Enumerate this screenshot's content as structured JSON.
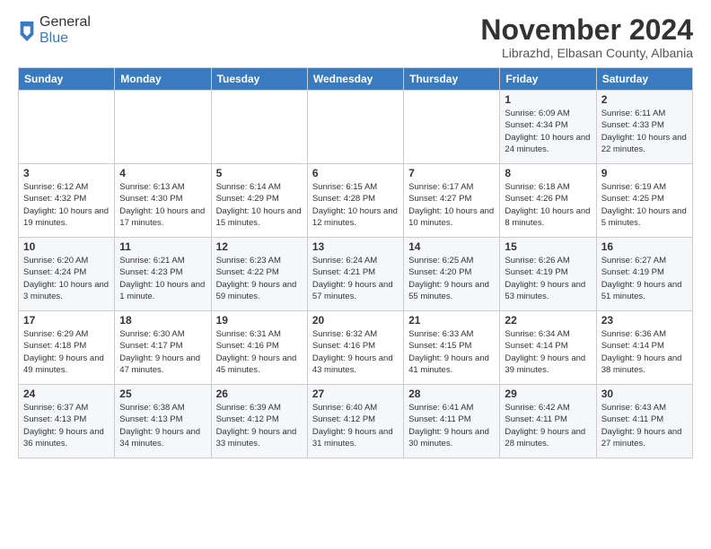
{
  "logo": {
    "general": "General",
    "blue": "Blue"
  },
  "header": {
    "month": "November 2024",
    "location": "Librazhd, Elbasan County, Albania"
  },
  "weekdays": [
    "Sunday",
    "Monday",
    "Tuesday",
    "Wednesday",
    "Thursday",
    "Friday",
    "Saturday"
  ],
  "weeks": [
    [
      {
        "day": "",
        "info": ""
      },
      {
        "day": "",
        "info": ""
      },
      {
        "day": "",
        "info": ""
      },
      {
        "day": "",
        "info": ""
      },
      {
        "day": "",
        "info": ""
      },
      {
        "day": "1",
        "info": "Sunrise: 6:09 AM\nSunset: 4:34 PM\nDaylight: 10 hours and 24 minutes."
      },
      {
        "day": "2",
        "info": "Sunrise: 6:11 AM\nSunset: 4:33 PM\nDaylight: 10 hours and 22 minutes."
      }
    ],
    [
      {
        "day": "3",
        "info": "Sunrise: 6:12 AM\nSunset: 4:32 PM\nDaylight: 10 hours and 19 minutes."
      },
      {
        "day": "4",
        "info": "Sunrise: 6:13 AM\nSunset: 4:30 PM\nDaylight: 10 hours and 17 minutes."
      },
      {
        "day": "5",
        "info": "Sunrise: 6:14 AM\nSunset: 4:29 PM\nDaylight: 10 hours and 15 minutes."
      },
      {
        "day": "6",
        "info": "Sunrise: 6:15 AM\nSunset: 4:28 PM\nDaylight: 10 hours and 12 minutes."
      },
      {
        "day": "7",
        "info": "Sunrise: 6:17 AM\nSunset: 4:27 PM\nDaylight: 10 hours and 10 minutes."
      },
      {
        "day": "8",
        "info": "Sunrise: 6:18 AM\nSunset: 4:26 PM\nDaylight: 10 hours and 8 minutes."
      },
      {
        "day": "9",
        "info": "Sunrise: 6:19 AM\nSunset: 4:25 PM\nDaylight: 10 hours and 5 minutes."
      }
    ],
    [
      {
        "day": "10",
        "info": "Sunrise: 6:20 AM\nSunset: 4:24 PM\nDaylight: 10 hours and 3 minutes."
      },
      {
        "day": "11",
        "info": "Sunrise: 6:21 AM\nSunset: 4:23 PM\nDaylight: 10 hours and 1 minute."
      },
      {
        "day": "12",
        "info": "Sunrise: 6:23 AM\nSunset: 4:22 PM\nDaylight: 9 hours and 59 minutes."
      },
      {
        "day": "13",
        "info": "Sunrise: 6:24 AM\nSunset: 4:21 PM\nDaylight: 9 hours and 57 minutes."
      },
      {
        "day": "14",
        "info": "Sunrise: 6:25 AM\nSunset: 4:20 PM\nDaylight: 9 hours and 55 minutes."
      },
      {
        "day": "15",
        "info": "Sunrise: 6:26 AM\nSunset: 4:19 PM\nDaylight: 9 hours and 53 minutes."
      },
      {
        "day": "16",
        "info": "Sunrise: 6:27 AM\nSunset: 4:19 PM\nDaylight: 9 hours and 51 minutes."
      }
    ],
    [
      {
        "day": "17",
        "info": "Sunrise: 6:29 AM\nSunset: 4:18 PM\nDaylight: 9 hours and 49 minutes."
      },
      {
        "day": "18",
        "info": "Sunrise: 6:30 AM\nSunset: 4:17 PM\nDaylight: 9 hours and 47 minutes."
      },
      {
        "day": "19",
        "info": "Sunrise: 6:31 AM\nSunset: 4:16 PM\nDaylight: 9 hours and 45 minutes."
      },
      {
        "day": "20",
        "info": "Sunrise: 6:32 AM\nSunset: 4:16 PM\nDaylight: 9 hours and 43 minutes."
      },
      {
        "day": "21",
        "info": "Sunrise: 6:33 AM\nSunset: 4:15 PM\nDaylight: 9 hours and 41 minutes."
      },
      {
        "day": "22",
        "info": "Sunrise: 6:34 AM\nSunset: 4:14 PM\nDaylight: 9 hours and 39 minutes."
      },
      {
        "day": "23",
        "info": "Sunrise: 6:36 AM\nSunset: 4:14 PM\nDaylight: 9 hours and 38 minutes."
      }
    ],
    [
      {
        "day": "24",
        "info": "Sunrise: 6:37 AM\nSunset: 4:13 PM\nDaylight: 9 hours and 36 minutes."
      },
      {
        "day": "25",
        "info": "Sunrise: 6:38 AM\nSunset: 4:13 PM\nDaylight: 9 hours and 34 minutes."
      },
      {
        "day": "26",
        "info": "Sunrise: 6:39 AM\nSunset: 4:12 PM\nDaylight: 9 hours and 33 minutes."
      },
      {
        "day": "27",
        "info": "Sunrise: 6:40 AM\nSunset: 4:12 PM\nDaylight: 9 hours and 31 minutes."
      },
      {
        "day": "28",
        "info": "Sunrise: 6:41 AM\nSunset: 4:11 PM\nDaylight: 9 hours and 30 minutes."
      },
      {
        "day": "29",
        "info": "Sunrise: 6:42 AM\nSunset: 4:11 PM\nDaylight: 9 hours and 28 minutes."
      },
      {
        "day": "30",
        "info": "Sunrise: 6:43 AM\nSunset: 4:11 PM\nDaylight: 9 hours and 27 minutes."
      }
    ]
  ]
}
